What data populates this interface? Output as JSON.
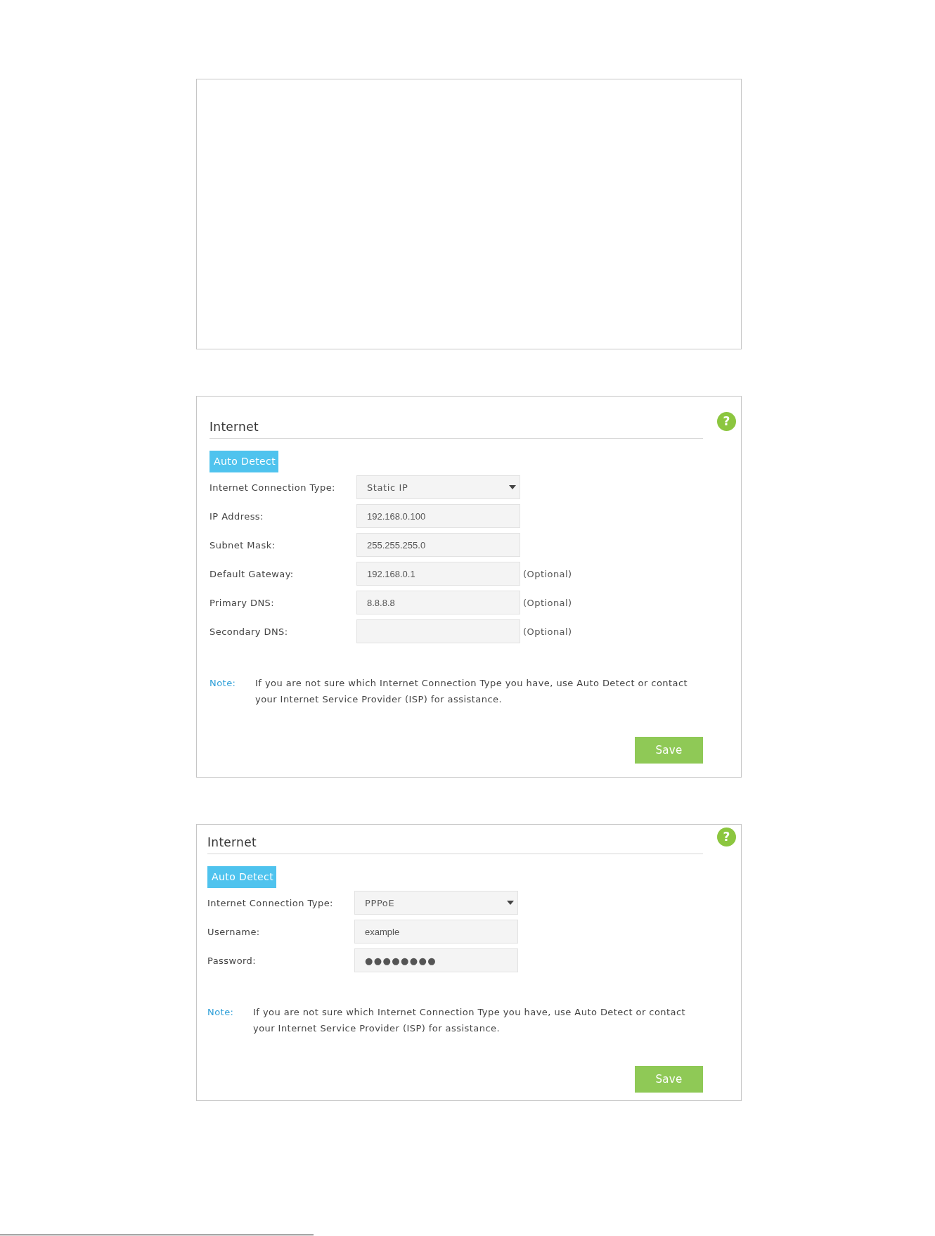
{
  "panels": [
    {
      "kind": "blank"
    },
    {
      "kind": "form",
      "title": "Internet",
      "help": "?",
      "auto_detect": "Auto Detect",
      "fields": [
        {
          "kind": "select",
          "label": "Internet Connection Type:",
          "value": "Static IP"
        },
        {
          "kind": "text",
          "label": "IP Address:",
          "value": "192.168.0.100"
        },
        {
          "kind": "text",
          "label": "Subnet Mask:",
          "value": "255.255.255.0"
        },
        {
          "kind": "text",
          "label": "Default Gateway:",
          "value": "192.168.0.1",
          "hint": "(Optional)"
        },
        {
          "kind": "text",
          "label": "Primary DNS:",
          "value": "8.8.8.8",
          "hint": "(Optional)"
        },
        {
          "kind": "text",
          "label": "Secondary DNS:",
          "hint": "(Optional)"
        }
      ],
      "note": {
        "label": "Note:",
        "text": "If you are not sure which Internet Connection Type you have, use Auto Detect or contact your Internet Service Provider (ISP) for assistance."
      },
      "save": "Save"
    },
    {
      "kind": "form",
      "title": "Internet",
      "help": "?",
      "auto_detect": "Auto Detect",
      "fields": [
        {
          "kind": "select",
          "label": "Internet Connection Type:",
          "value": "PPPoE"
        },
        {
          "kind": "text",
          "label": "Username:",
          "value": "example"
        },
        {
          "kind": "password",
          "label": "Password:",
          "value": "●●●●●●●●"
        }
      ],
      "note": {
        "label": "Note:",
        "text": "If you are not sure which Internet Connection Type you have, use Auto Detect or contact your Internet Service Provider (ISP) for assistance."
      },
      "save": "Save"
    }
  ]
}
